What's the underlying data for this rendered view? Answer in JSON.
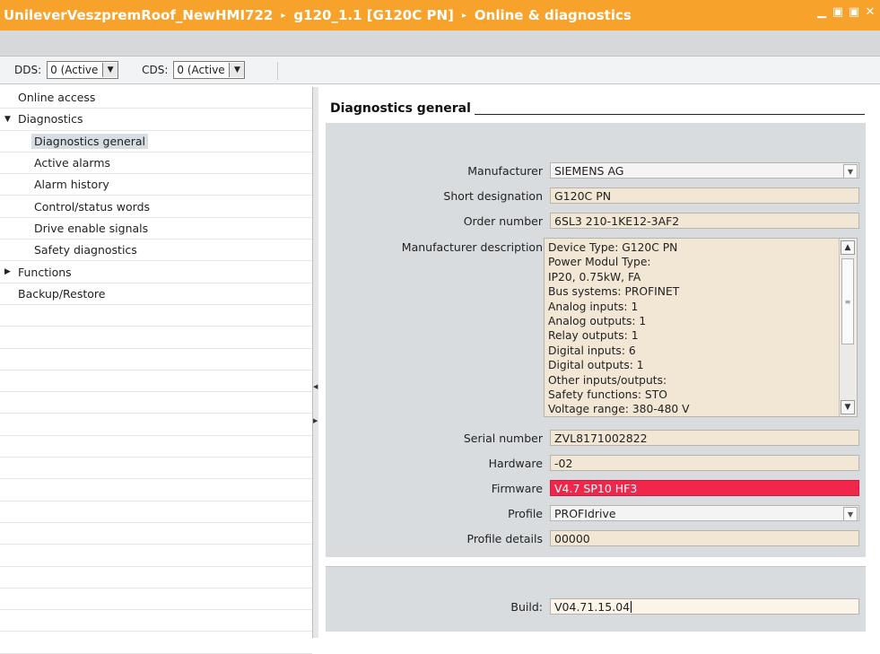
{
  "titlebar": {
    "crumbs": [
      "UnileverVeszpremRoof_NewHMI722",
      "g120_1.1 [G120C PN]",
      "Online & diagnostics"
    ],
    "separator": "▸",
    "window_buttons": [
      "▁",
      "▣",
      "▣",
      "✕"
    ],
    "color": "#f7a22a"
  },
  "dataset_bar": {
    "dds_label": "DDS:",
    "dds_value": "0 (Active",
    "cds_label": "CDS:",
    "cds_value": "0 (Active"
  },
  "tree": {
    "items": [
      {
        "label": "Online access",
        "level": 0,
        "toggle": ""
      },
      {
        "label": "Diagnostics",
        "level": 0,
        "toggle": "▼"
      },
      {
        "label": "Diagnostics general",
        "level": 1,
        "toggle": "",
        "selected": true
      },
      {
        "label": "Active alarms",
        "level": 1,
        "toggle": ""
      },
      {
        "label": "Alarm history",
        "level": 1,
        "toggle": ""
      },
      {
        "label": "Control/status words",
        "level": 1,
        "toggle": ""
      },
      {
        "label": "Drive enable signals",
        "level": 1,
        "toggle": ""
      },
      {
        "label": "Safety diagnostics",
        "level": 1,
        "toggle": ""
      },
      {
        "label": "Functions",
        "level": 0,
        "toggle": "▶"
      },
      {
        "label": "Backup/Restore",
        "level": 0,
        "toggle": ""
      }
    ]
  },
  "main": {
    "section_title": "Diagnostics general",
    "manufacturer": {
      "label": "Manufacturer",
      "value": "SIEMENS AG"
    },
    "short_designation": {
      "label": "Short designation",
      "value": "G120C PN"
    },
    "order_number": {
      "label": "Order number",
      "value": "6SL3 210-1KE12-3AF2"
    },
    "manufacturer_description": {
      "label": "Manufacturer description",
      "lines": [
        "Device Type: G120C PN",
        "Power Modul Type:",
        "IP20, 0.75kW, FA",
        "Bus systems: PROFINET",
        "Analog inputs: 1",
        "Analog outputs: 1",
        "Relay outputs: 1",
        "Digital inputs: 6",
        "Digital outputs: 1",
        "Other inputs/outputs:",
        "Safety functions: STO",
        "Voltage range: 380-480 V"
      ]
    },
    "serial_number": {
      "label": "Serial number",
      "value": "ZVL8171002822"
    },
    "hardware": {
      "label": "Hardware",
      "value": "-02"
    },
    "firmware": {
      "label": "Firmware",
      "value": "V4.7 SP10 HF3",
      "color": "#f0264c"
    },
    "profile": {
      "label": "Profile",
      "value": "PROFIdrive"
    },
    "profile_details": {
      "label": "Profile details",
      "value": "00000"
    },
    "build": {
      "label": "Build:",
      "value": "V04.71.15.04"
    }
  }
}
